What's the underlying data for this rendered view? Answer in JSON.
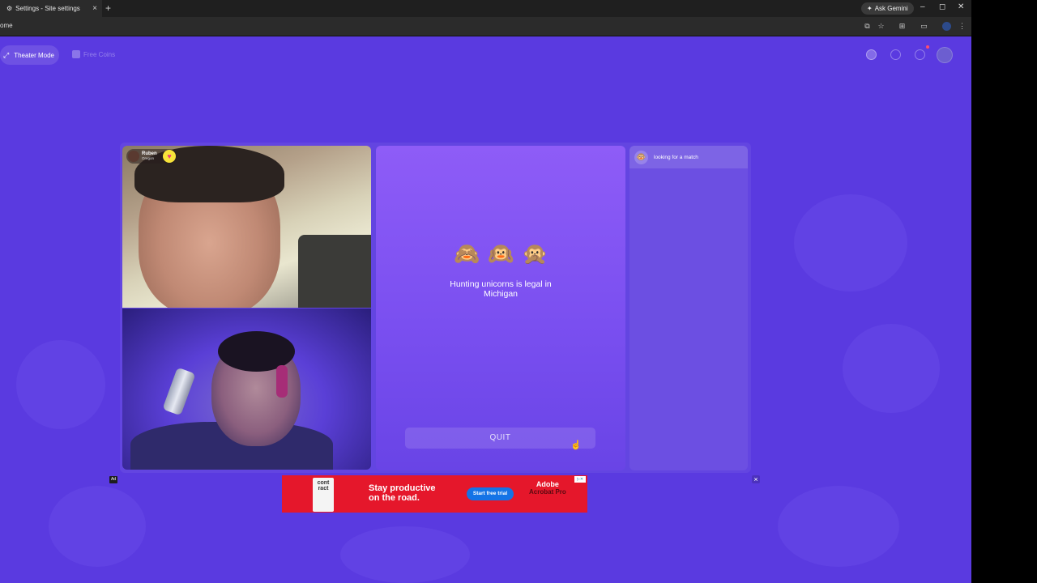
{
  "browser": {
    "tab_title": "Settings - Site settings",
    "tab_close": "×",
    "new_tab": "+",
    "ask_gemini": "Ask Gemini",
    "address_fragment": "ome",
    "window_controls": [
      "–",
      "◻",
      "✕"
    ]
  },
  "header": {
    "theater_mode": "Theater Mode",
    "free_coins": "Free Coins"
  },
  "video": {
    "remote_user": {
      "name": "Ruben",
      "location": "Oregon"
    }
  },
  "center": {
    "emojis": [
      "🙈",
      "🙉",
      "🙊"
    ],
    "fact": "Hunting unicorns is legal in Michigan",
    "quit_label": "QUIT"
  },
  "chat": {
    "status": "looking for a match",
    "avatar_emoji": "🐵"
  },
  "ad": {
    "badge": "Ad",
    "book_text": "cont\nract",
    "headline": "Stay productive\non the road.",
    "cta": "Start free trial",
    "brand": "Adobe",
    "product": "Acrobat Pro",
    "close": "×"
  },
  "colors": {
    "page_bg": "#5a3ae0",
    "center_top": "#8e5cf7",
    "ad_red": "#e5172b",
    "cta_blue": "#1473e6"
  }
}
